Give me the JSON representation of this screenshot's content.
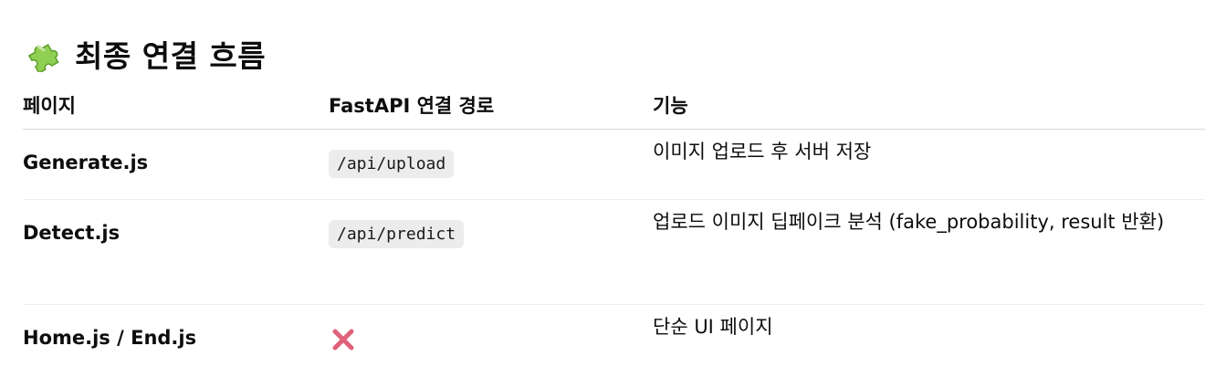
{
  "heading": {
    "icon": "puzzle-piece-icon",
    "title": "최종 연결 흐름"
  },
  "table": {
    "headers": [
      "페이지",
      "FastAPI 연결 경로",
      "기능"
    ],
    "rows": [
      {
        "page": "Generate.js",
        "route": "/api/upload",
        "function": "이미지 업로드 후 서버 저장"
      },
      {
        "page": "Detect.js",
        "route": "/api/predict",
        "function": "업로드 이미지 딥페이크 분석 (fake_probability, result 반환)"
      },
      {
        "page": "Home.js / End.js",
        "route_icon": "cross-mark-icon",
        "function": "단순 UI 페이지"
      }
    ]
  },
  "colors": {
    "cross_mark": "#e0627a",
    "code_background": "#ececec",
    "puzzle_green": "#7cc04b"
  }
}
